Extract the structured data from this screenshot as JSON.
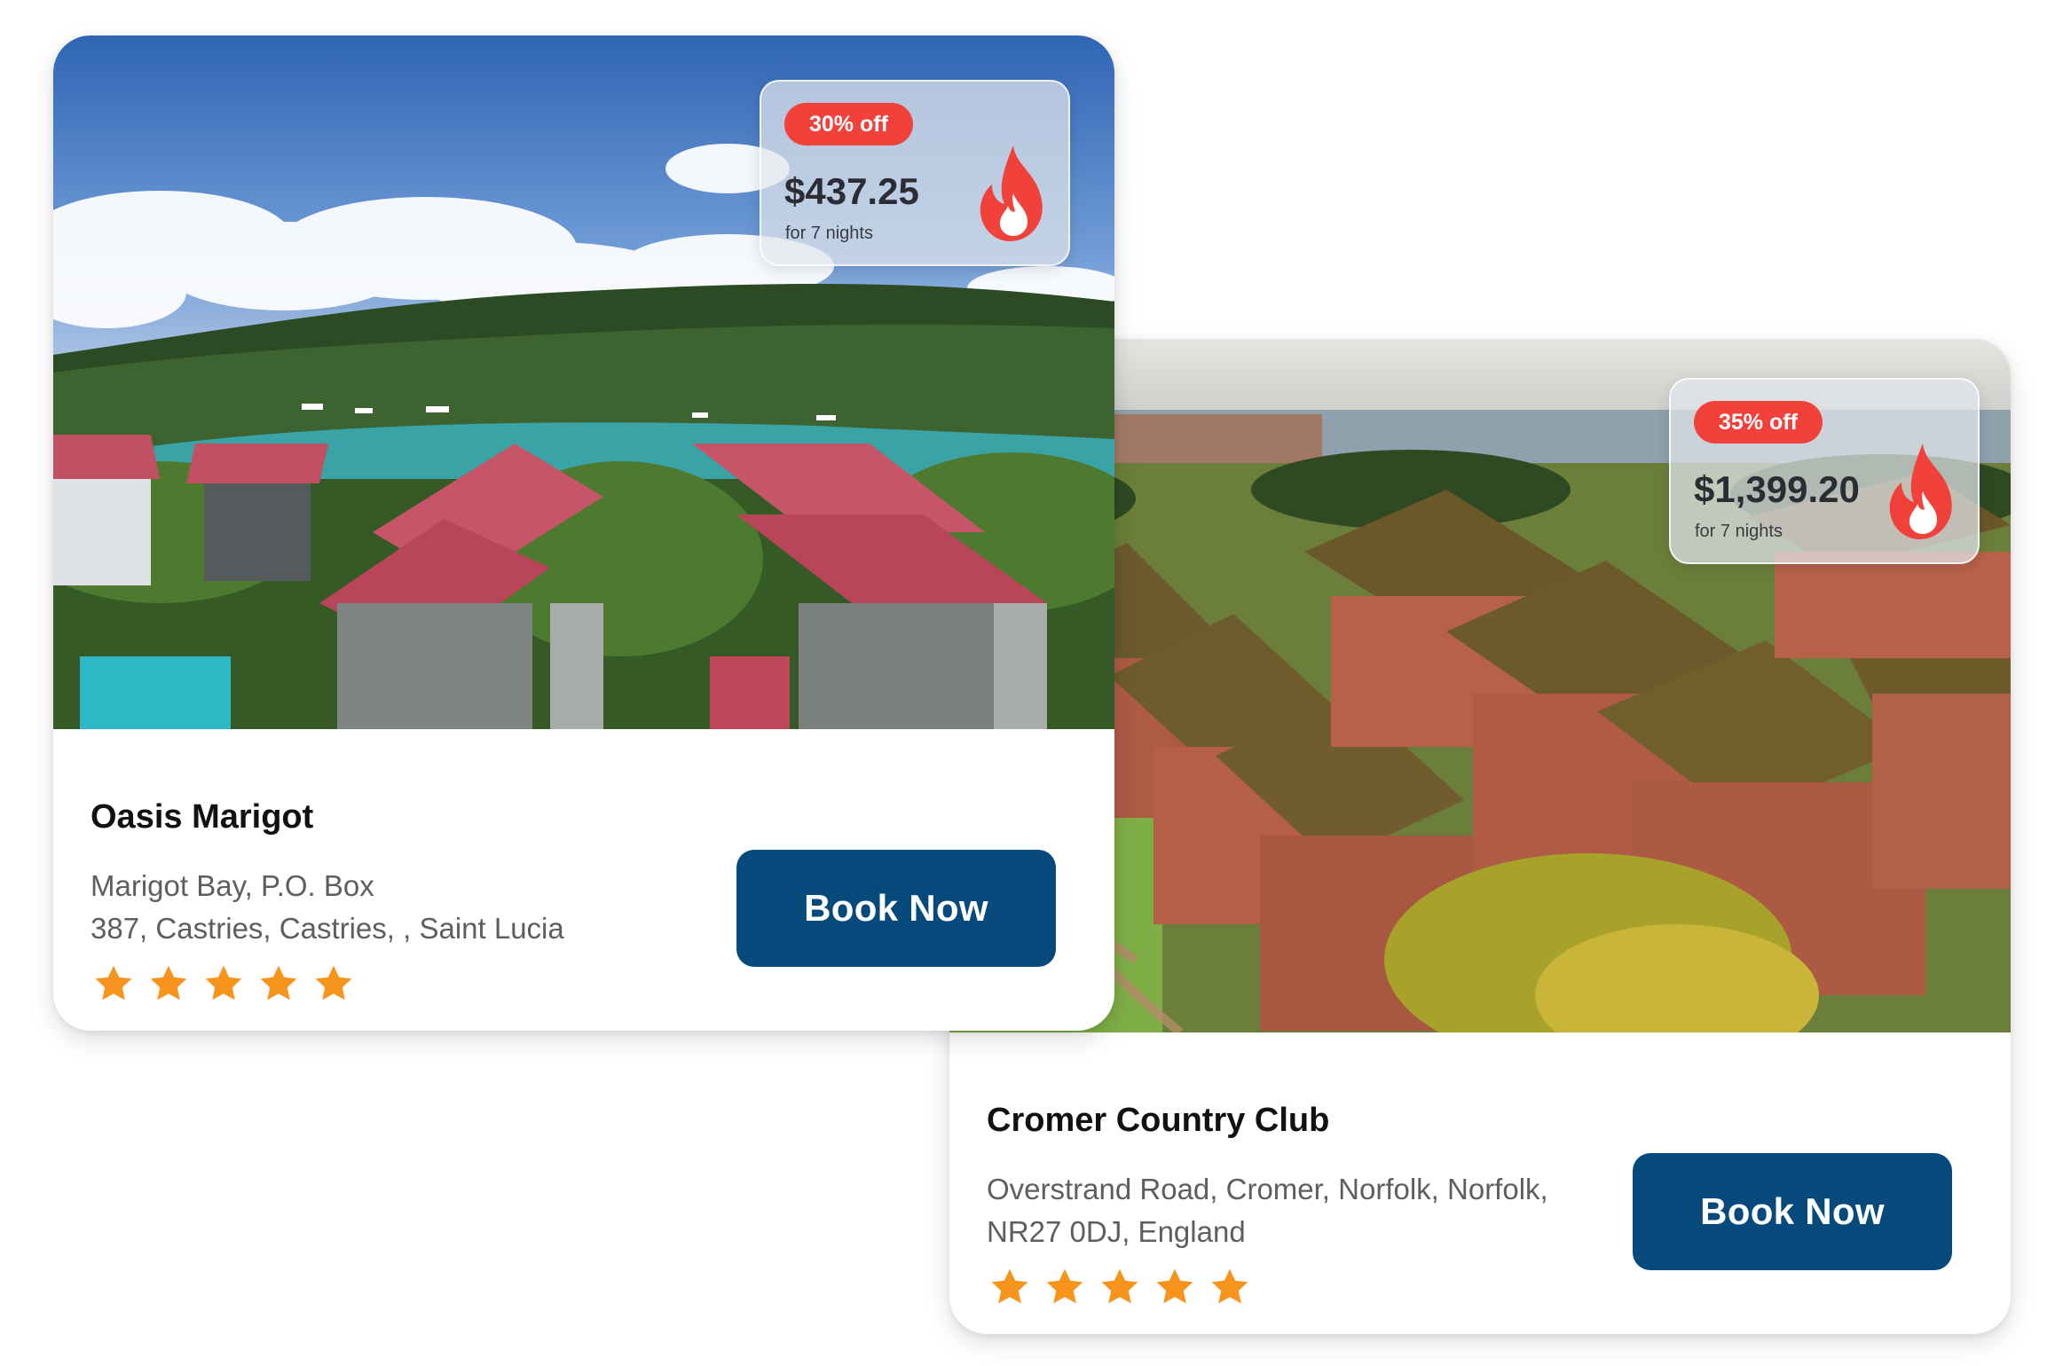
{
  "colors": {
    "book_button_bg": "#064a7b",
    "discount_badge_bg": "#f0413b",
    "star": "#f7941d",
    "fire": "#f0413b"
  },
  "cards": [
    {
      "name": "Oasis Marigot",
      "address_lines": [
        "Marigot Bay, P.O. Box",
        "387, Castries, Castries, , Saint Lucia"
      ],
      "rating": 5,
      "deal": {
        "discount": "30% off",
        "price": "$437.25",
        "note": "for 7 nights",
        "icon": "fire-icon"
      },
      "button_label": "Book Now",
      "photo": "tropical bay resort with red-roofed villas"
    },
    {
      "name": "Cromer Country Club",
      "address_lines": [
        "Overstrand Road, Cromer, Norfolk, Norfolk,",
        "NR27 0DJ, England"
      ],
      "rating": 5,
      "deal": {
        "discount": "35% off",
        "price": "$1,399.20",
        "note": "for 7 nights",
        "icon": "fire-icon"
      },
      "button_label": "Book Now",
      "photo": "aerial view of brick terraced holiday homes by the sea"
    }
  ]
}
